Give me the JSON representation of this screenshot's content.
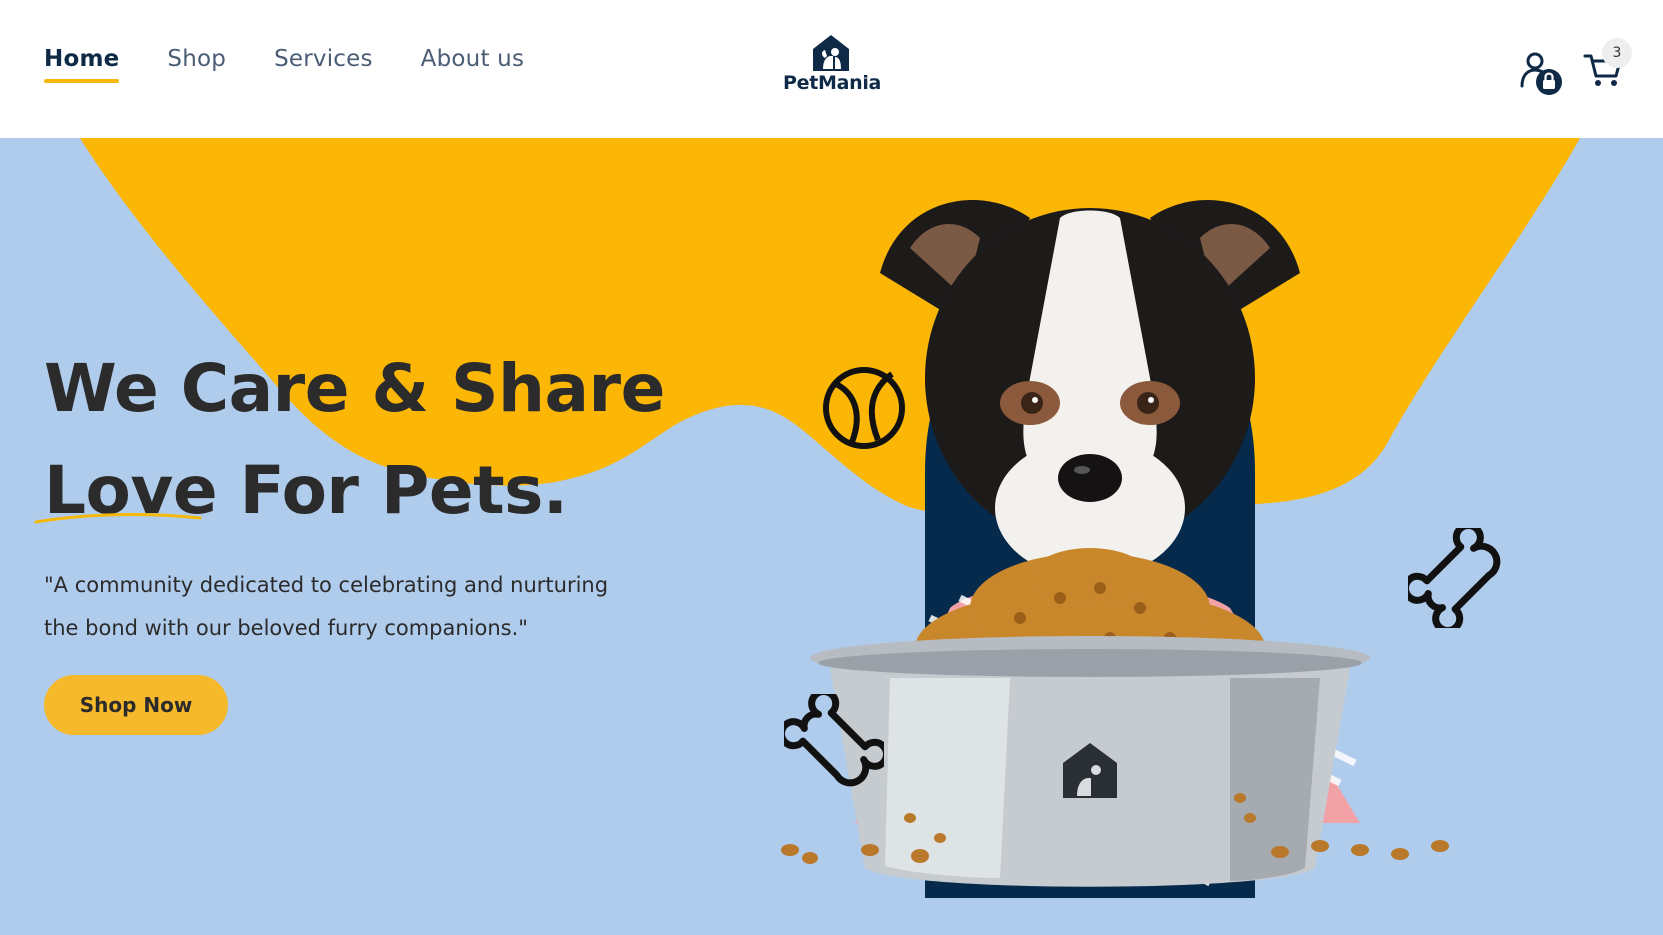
{
  "nav": {
    "items": [
      {
        "label": "Home",
        "active": true
      },
      {
        "label": "Shop",
        "active": false
      },
      {
        "label": "Services",
        "active": false
      },
      {
        "label": "About us",
        "active": false
      }
    ]
  },
  "brand": {
    "name": "PetMania",
    "icon": "house-pet-icon"
  },
  "header_actions": {
    "account_icon": "user-lock-icon",
    "cart_icon": "cart-icon",
    "cart_count": "3"
  },
  "hero": {
    "headline_line1": "We Care & Share",
    "headline_line2": "Love For Pets.",
    "tagline_line1": "\"A community dedicated to celebrating and nurturing",
    "tagline_line2": "the bond with our beloved furry companions.\"",
    "cta_label": "Shop Now",
    "image_alt": "puppy-with-food-bowl",
    "decorations": [
      "tennis-ball-icon",
      "bone-icon",
      "bone-icon"
    ]
  },
  "colors": {
    "accent": "#f7b80a",
    "hero_background": "#b0ccec",
    "brand_navy": "#0e2a47",
    "cta": "#f7b92c"
  }
}
